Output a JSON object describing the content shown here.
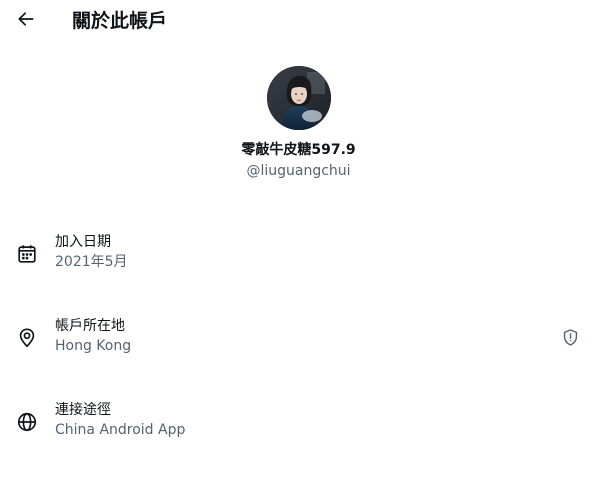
{
  "header": {
    "back_icon": "arrow-left-icon",
    "title": "關於此帳戶"
  },
  "profile": {
    "display_name": "零敲牛皮糖597.9",
    "handle": "@liuguangchui"
  },
  "rows": [
    {
      "icon": "calendar-icon",
      "label": "加入日期",
      "value": "2021年5月"
    },
    {
      "icon": "location-pin-icon",
      "label": "帳戶所在地",
      "value": "Hong Kong",
      "trailing_icon": "shield-info-icon"
    },
    {
      "icon": "globe-icon",
      "label": "連接途徑",
      "value": "China Android App"
    }
  ],
  "colors": {
    "primary_text": "#0f1419",
    "secondary_text": "#536471",
    "background": "#ffffff"
  }
}
